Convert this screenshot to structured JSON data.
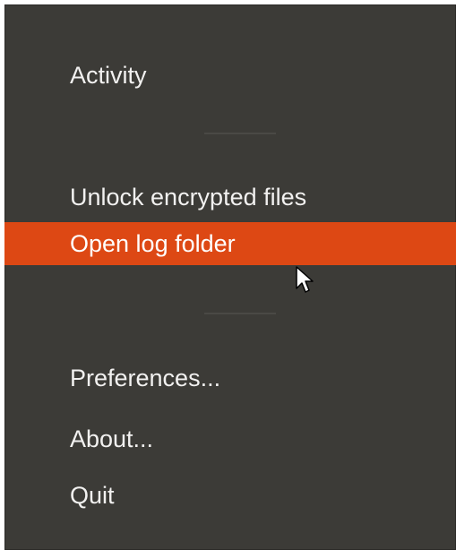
{
  "menu": {
    "items": [
      {
        "label": "Activity"
      },
      {
        "label": "Unlock encrypted files"
      },
      {
        "label": "Open log folder"
      },
      {
        "label": "Preferences..."
      },
      {
        "label": "About..."
      },
      {
        "label": "Quit"
      }
    ],
    "highlight_color": "#dd4814",
    "background_color": "#3c3b37"
  },
  "cursor": {
    "icon": "mouse-pointer-icon"
  }
}
